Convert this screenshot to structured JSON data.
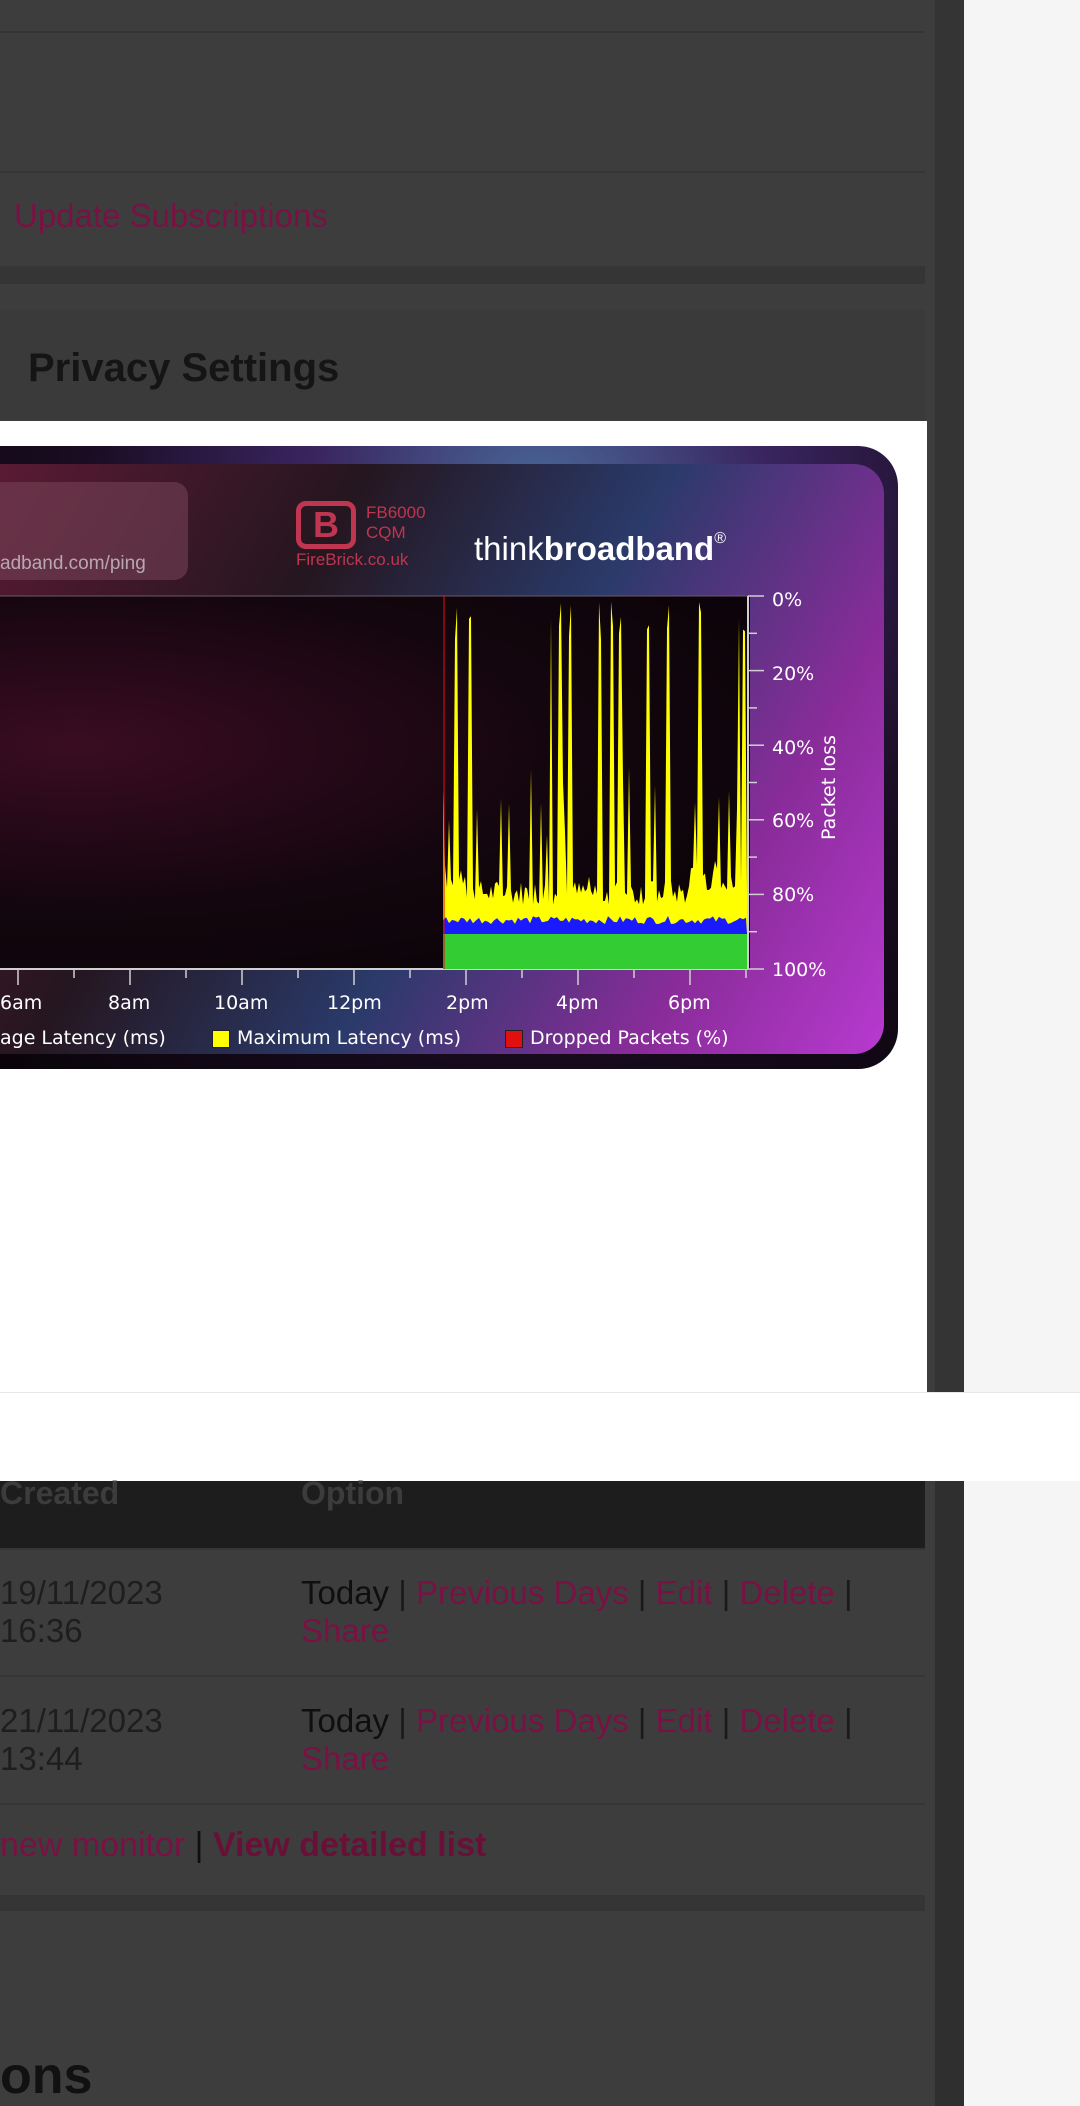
{
  "links": {
    "update_subscriptions": "Update Subscriptions"
  },
  "privacy": {
    "title": "Privacy Settings"
  },
  "graph": {
    "url_text": "adband.com/ping",
    "firebrick_lines": [
      "FB6000",
      "CQM",
      "FireBrick.co.uk"
    ],
    "tbb_thin": "think",
    "tbb_bold": "broadband",
    "tbb_mark": "®",
    "y_ticks": [
      "0%",
      "20%",
      "40%",
      "60%",
      "80%",
      "100%"
    ],
    "y_title": "Packet loss",
    "x_ticks": [
      "6am",
      "8am",
      "10am",
      "12pm",
      "2pm",
      "4pm",
      "6pm"
    ],
    "legend": [
      {
        "label": "age Latency (ms)",
        "color": ""
      },
      {
        "label": "Maximum Latency (ms)",
        "color": "#ffff00"
      },
      {
        "label": "Dropped Packets (%)",
        "color": "#e01010"
      }
    ],
    "colors": {
      "max_latency": "#ffff00",
      "avg_latency": "#1a1aff",
      "min_latency": "#33cc33",
      "dropped": "#e01010"
    }
  },
  "table": {
    "headers": {
      "created": "Created",
      "option": "Option"
    },
    "rows": [
      {
        "created_date": "19/11/2023",
        "created_time": "16:36"
      },
      {
        "created_date": "21/11/2023",
        "created_time": "13:44"
      }
    ],
    "options": {
      "today": "Today",
      "sep": "|",
      "previous": "Previous Days",
      "edit": "Edit",
      "delete": "Delete",
      "share": "Share"
    }
  },
  "footer": {
    "new_monitor": "new monitor",
    "sep": "|",
    "detailed": "View detailed list"
  },
  "section": {
    "heading_fragment": "ons"
  }
}
